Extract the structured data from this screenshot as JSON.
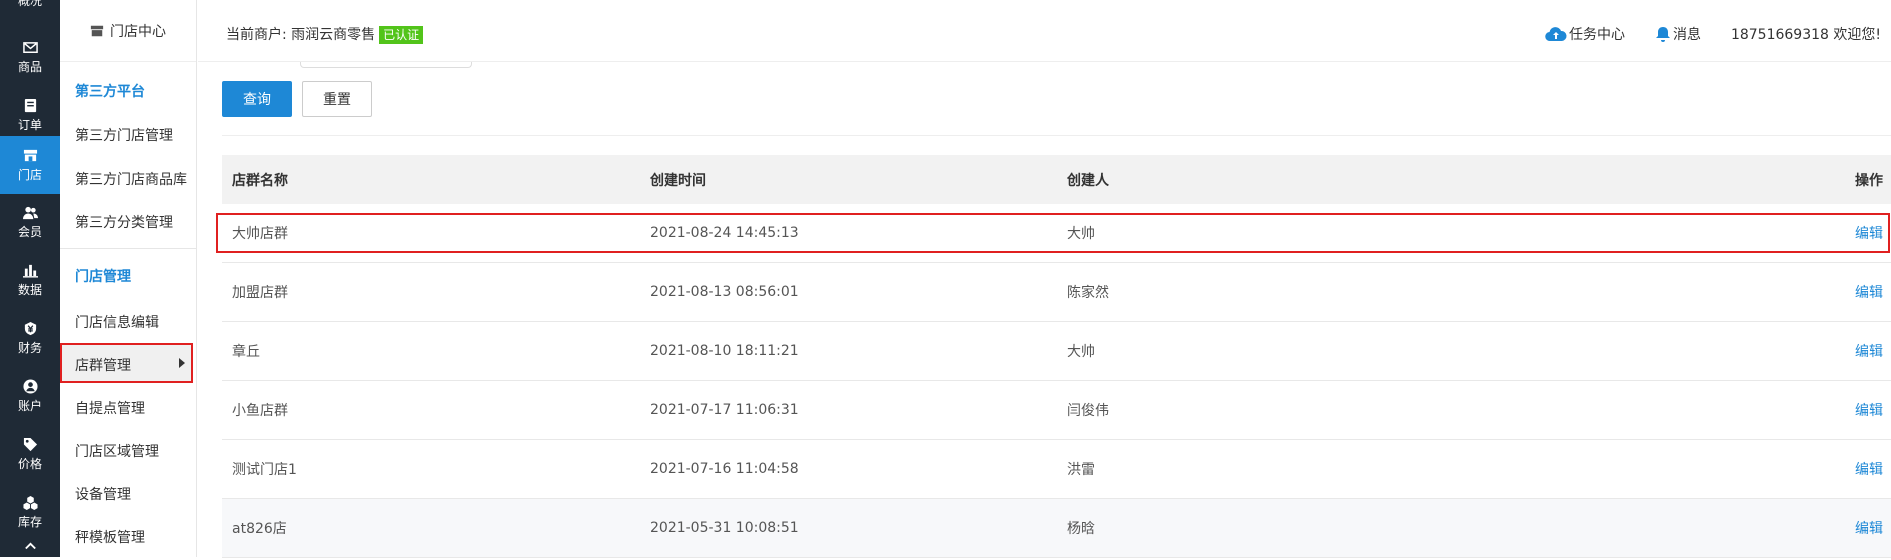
{
  "nav": {
    "top_label": "概况",
    "items": [
      {
        "label": "商品",
        "icon": "mail-icon"
      },
      {
        "label": "订单",
        "icon": "order-icon"
      },
      {
        "label": "门店",
        "icon": "store-icon"
      },
      {
        "label": "会员",
        "icon": "members-icon"
      },
      {
        "label": "数据",
        "icon": "chart-icon"
      },
      {
        "label": "财务",
        "icon": "finance-icon"
      },
      {
        "label": "账户",
        "icon": "account-icon"
      },
      {
        "label": "价格",
        "icon": "tag-icon"
      },
      {
        "label": "库存",
        "icon": "inventory-icon"
      }
    ],
    "active_index": 2
  },
  "submenu": {
    "title": "门店中心",
    "group1": "第三方平台",
    "group1_items": [
      "第三方门店管理",
      "第三方门店商品库",
      "第三方分类管理"
    ],
    "group2": "门店管理",
    "group2_items": [
      "门店信息编辑",
      "店群管理",
      "自提点管理",
      "门店区域管理",
      "设备管理",
      "秤模板管理"
    ]
  },
  "header": {
    "merchant_label": "当前商户: 雨润云商零售",
    "verified_badge": "已认证",
    "task_center": "任务中心",
    "messages": "消息",
    "welcome": "18751669318 欢迎您!"
  },
  "buttons": {
    "query": "查询",
    "reset": "重置"
  },
  "table": {
    "headers": [
      "店群名称",
      "创建时间",
      "创建人",
      "操作"
    ],
    "rows": [
      {
        "name": "大帅店群",
        "created": "2021-08-24 14:45:13",
        "creator": "大帅",
        "action": "编辑"
      },
      {
        "name": "加盟店群",
        "created": "2021-08-13 08:56:01",
        "creator": "陈家然",
        "action": "编辑"
      },
      {
        "name": "章丘",
        "created": "2021-08-10 18:11:21",
        "creator": "大帅",
        "action": "编辑"
      },
      {
        "name": "小鱼店群",
        "created": "2021-07-17 11:06:31",
        "creator": "闫俊伟",
        "action": "编辑"
      },
      {
        "name": "测试门店1",
        "created": "2021-07-16 11:04:58",
        "creator": "洪雷",
        "action": "编辑"
      },
      {
        "name": "at826店",
        "created": "2021-05-31 10:08:51",
        "creator": "杨晗",
        "action": "编辑"
      }
    ]
  },
  "colors": {
    "accent": "#1e88d6",
    "nav_bg": "#1f2a36",
    "highlight": "#e02020",
    "badge": "#52c41a"
  }
}
